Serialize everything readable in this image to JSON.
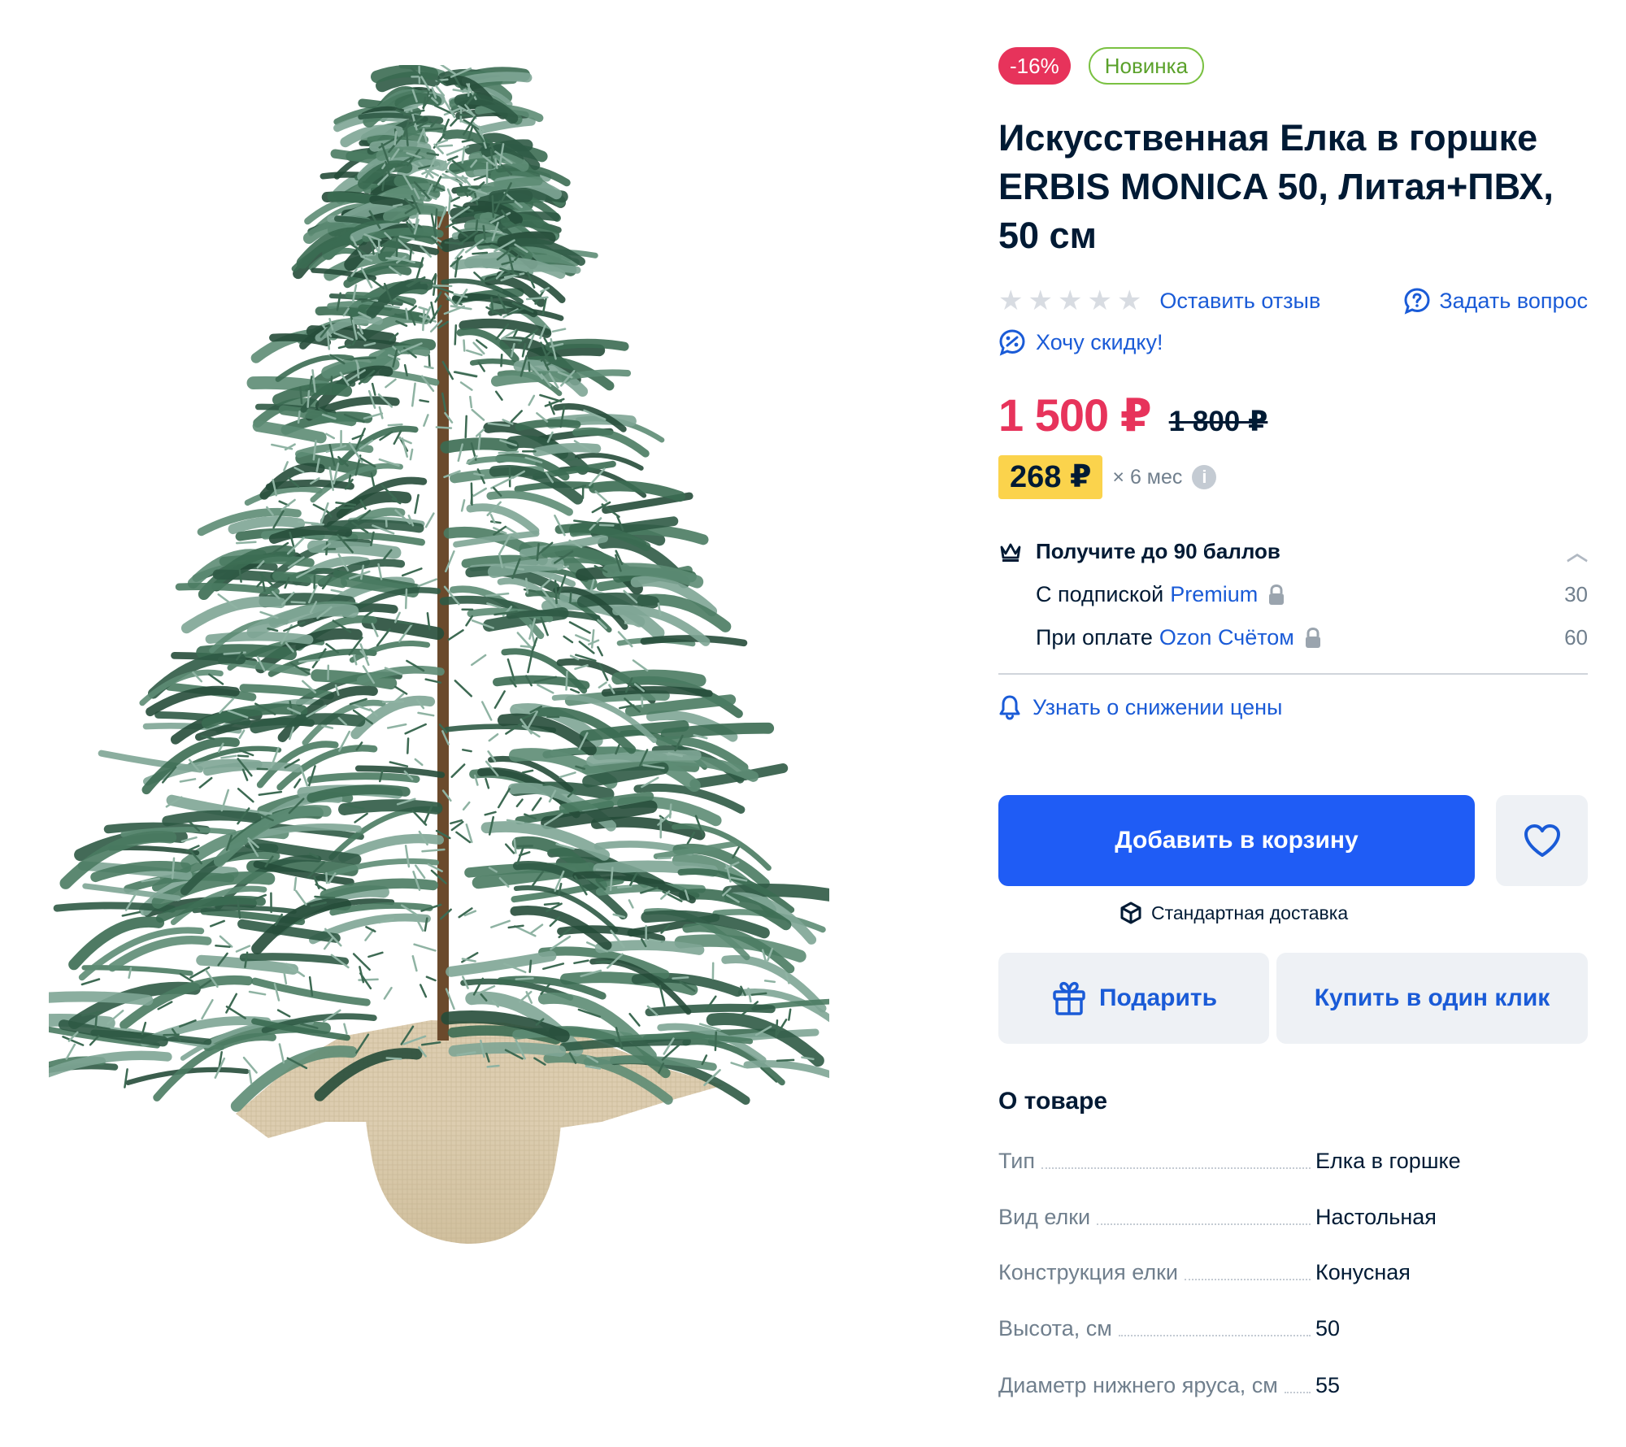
{
  "badges": {
    "sale": "-16%",
    "new": "Новинка"
  },
  "title": "Искусственная Елка в горшке ERBIS MONICA 50, Литая+ПВХ, 50 см",
  "rating": {
    "stars": 5,
    "filled": 0,
    "review_link": "Оставить отзыв",
    "question_link": "Задать вопрос"
  },
  "discount_request": "Хочу скидку!",
  "price": {
    "current": "1 500 ₽",
    "old": "1 800 ₽"
  },
  "installment": {
    "amount": "268 ₽",
    "term": "× 6 мес",
    "info_icon": "i"
  },
  "points": {
    "heading": "Получите до 90 баллов",
    "lines": [
      {
        "label": "С подпиской",
        "accent": "Premium",
        "value": "30"
      },
      {
        "label": "При оплате",
        "accent": "Ozon Счётом",
        "value": "60"
      }
    ]
  },
  "price_alert": "Узнать о снижении цены",
  "actions": {
    "add_to_cart": "Добавить в корзину",
    "delivery": "Стандартная доставка",
    "gift": "Подарить",
    "one_click": "Купить в один клик"
  },
  "about": {
    "title": "О товаре",
    "specs": [
      {
        "name": "Тип",
        "value": "Елка в горшке"
      },
      {
        "name": "Вид елки",
        "value": "Настольная"
      },
      {
        "name": "Конструкция елки",
        "value": "Конусная"
      },
      {
        "name": "Высота, см",
        "value": "50"
      },
      {
        "name": "Диаметр нижнего яруса, см",
        "value": "55"
      }
    ]
  },
  "colors": {
    "accent": "#1f5cf5",
    "link": "#1a5bd7",
    "sale": "#e7335b",
    "installment": "#fbd34c",
    "new_badge": "#7ac142"
  },
  "icons": [
    "question-icon",
    "discount-chat-icon",
    "crown-icon",
    "chevron-up-icon",
    "lock-icon",
    "bell-icon",
    "heart-icon",
    "box-icon",
    "gift-icon",
    "info-icon"
  ]
}
